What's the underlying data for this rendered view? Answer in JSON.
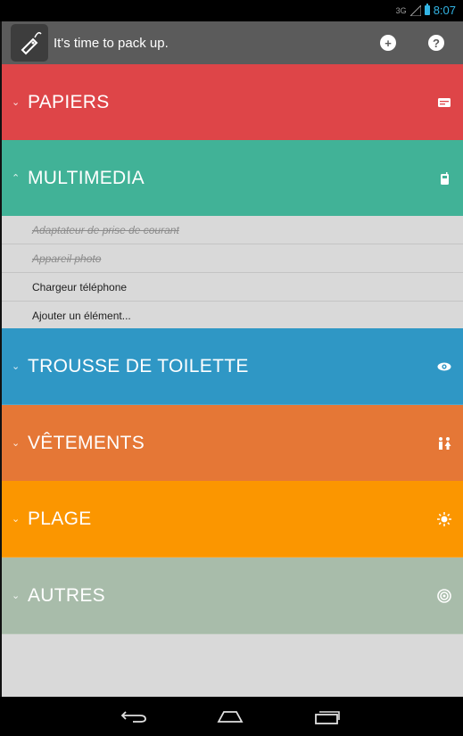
{
  "status_bar": {
    "network": "3G",
    "time": "8:07"
  },
  "action_bar": {
    "title": "It's time to pack up.",
    "icons": {
      "app": "luggage-tag-icon",
      "add": "add-circle-icon",
      "help": "help-circle-icon"
    }
  },
  "categories": [
    {
      "title": "PAPIERS",
      "color": "#de4548",
      "icon": "wallet-icon",
      "expanded": false
    },
    {
      "title": "MULTIMEDIA",
      "color": "#41b297",
      "icon": "phone-icon",
      "expanded": true
    },
    {
      "title": "TROUSSE DE TOILETTE",
      "color": "#2f97c5",
      "icon": "eye-icon",
      "expanded": false
    },
    {
      "title": "VÊTEMENTS",
      "color": "#e57736",
      "icon": "people-icon",
      "expanded": false
    },
    {
      "title": "PLAGE",
      "color": "#fb9600",
      "icon": "sun-icon",
      "expanded": false
    },
    {
      "title": "AUTRES",
      "color": "#a8bcaa",
      "icon": "target-icon",
      "expanded": false
    }
  ],
  "multimedia_items": [
    {
      "label": "Adaptateur de prise de courant",
      "checked": true
    },
    {
      "label": "Appareil photo",
      "checked": true
    },
    {
      "label": "Chargeur téléphone",
      "checked": false
    }
  ],
  "add_item_label": "Ajouter un élément...",
  "nav_bar": {
    "icons": [
      "back-icon",
      "home-icon",
      "recent-apps-icon"
    ]
  }
}
